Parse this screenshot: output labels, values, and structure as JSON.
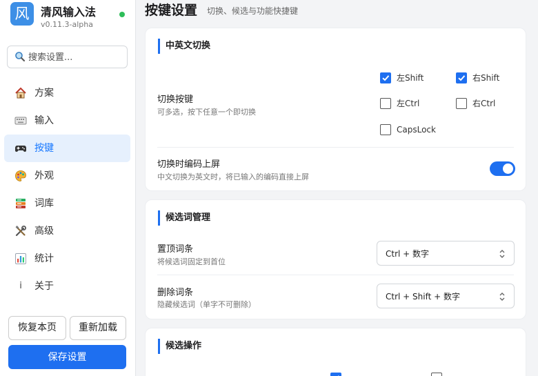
{
  "app": {
    "name": "清风输入法",
    "version": "v0.11.3-alpha",
    "logo_char": "风",
    "status_color": "#2ebd59"
  },
  "search": {
    "placeholder": "搜索设置..."
  },
  "sidebar": {
    "items": [
      {
        "label": "方案",
        "icon": "house-icon",
        "active": false
      },
      {
        "label": "输入",
        "icon": "keyboard-icon",
        "active": false
      },
      {
        "label": "按键",
        "icon": "gamepad-icon",
        "active": true
      },
      {
        "label": "外观",
        "icon": "palette-icon",
        "active": false
      },
      {
        "label": "词库",
        "icon": "books-icon",
        "active": false
      },
      {
        "label": "高级",
        "icon": "tools-icon",
        "active": false
      },
      {
        "label": "统计",
        "icon": "bar-chart-icon",
        "active": false
      },
      {
        "label": "关于",
        "icon": "info-icon",
        "active": false
      }
    ],
    "restore_label": "恢复本页",
    "reload_label": "重新加载",
    "save_label": "保存设置"
  },
  "header": {
    "title": "按键设置",
    "subtitle": "切换、候选与功能快捷键"
  },
  "sections": {
    "switch": {
      "title": "中英文切换",
      "toggle_key": {
        "label": "切换按键",
        "desc": "可多选，按下任意一个即切换",
        "options": [
          {
            "label": "左Shift",
            "checked": true
          },
          {
            "label": "右Shift",
            "checked": true
          },
          {
            "label": "左Ctrl",
            "checked": false
          },
          {
            "label": "右Ctrl",
            "checked": false
          },
          {
            "label": "CapsLock",
            "checked": false
          }
        ]
      },
      "commit_on_switch": {
        "label": "切换时编码上屏",
        "desc": "中文切换为英文时，将已输入的编码直接上屏",
        "enabled": true
      }
    },
    "candidates": {
      "title": "候选词管理",
      "pin": {
        "label": "置顶词条",
        "desc": "将候选词固定到首位",
        "value": "Ctrl + 数字"
      },
      "delete": {
        "label": "删除词条",
        "desc": "隐藏候选词（单字不可删除）",
        "value": "Ctrl + Shift + 数字"
      }
    },
    "operations": {
      "title": "候选操作"
    }
  },
  "colors": {
    "accent": "#1e6ff0",
    "active_bg": "#e6f0fd"
  }
}
